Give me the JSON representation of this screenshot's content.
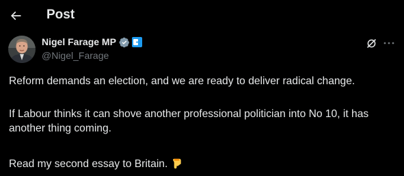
{
  "header": {
    "title": "Post",
    "back_icon": "arrow-left-icon"
  },
  "author": {
    "display_name": "Nigel Farage MP",
    "handle": "@Nigel_Farage",
    "verified_badge": "verified-badge-icon",
    "affiliate_badge": "affiliate-badge-icon",
    "verified_color": "#829aab",
    "affiliate_color": "#1d9bf0"
  },
  "actions": {
    "grok_icon": "grok-icon",
    "more_icon": "more-dots-icon"
  },
  "post": {
    "line1": "Reform demands an election, and we are ready to deliver radical change.",
    "line2": "If Labour thinks it can shove another professional politician into No 10, it has another thing coming.",
    "line3": "Read my second essay to Britain.",
    "emoji": "pointing-down-emoji"
  },
  "colors": {
    "background": "#000000",
    "text": "#e7e9ea",
    "secondary": "#71767b"
  }
}
